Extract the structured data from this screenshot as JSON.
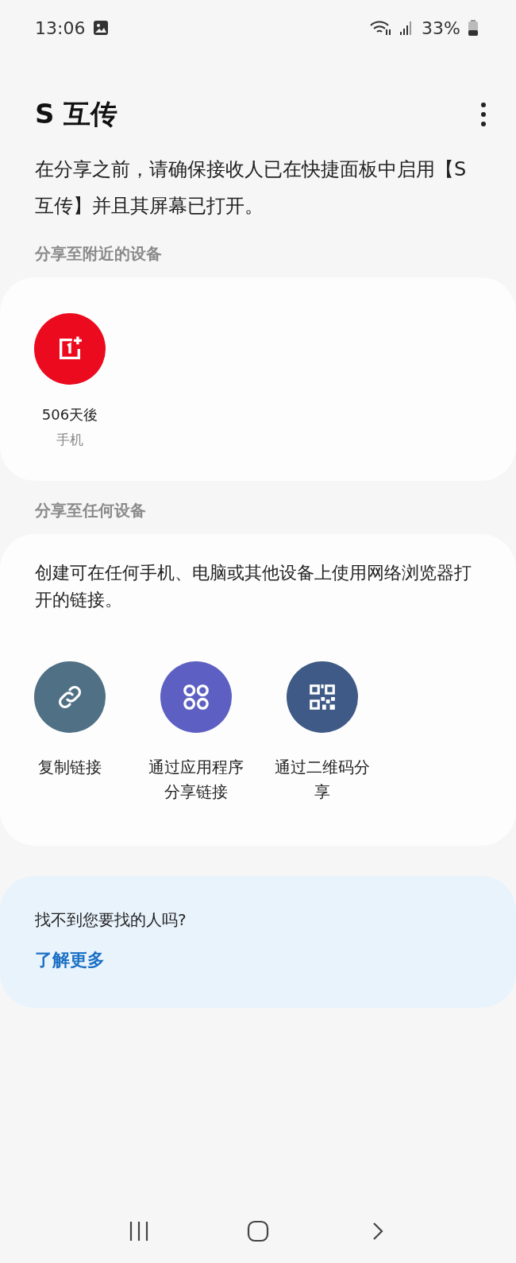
{
  "status_bar": {
    "time": "13:06",
    "battery": "33%"
  },
  "header": {
    "title": "S 互传"
  },
  "intro": "在分享之前，请确保接收人已在快捷面板中启用【S互传】并且其屏幕已打开。",
  "nearby": {
    "heading": "分享至附近的设备",
    "devices": [
      {
        "name": "506天後",
        "type": "手机"
      }
    ]
  },
  "any_device": {
    "heading": "分享至任何设备",
    "description": "创建可在任何手机、电脑或其他设备上使用网络浏览器打开的链接。",
    "actions": [
      {
        "kind": "link",
        "label": "复制链接",
        "color": "#4f7085"
      },
      {
        "kind": "apps",
        "label": "通过应用程序分享链接",
        "color": "#5d60c2"
      },
      {
        "kind": "qr",
        "label": "通过二维码分享",
        "color": "#3f5a86"
      }
    ]
  },
  "help": {
    "question": "找不到您要找的人吗?",
    "link": "了解更多"
  }
}
